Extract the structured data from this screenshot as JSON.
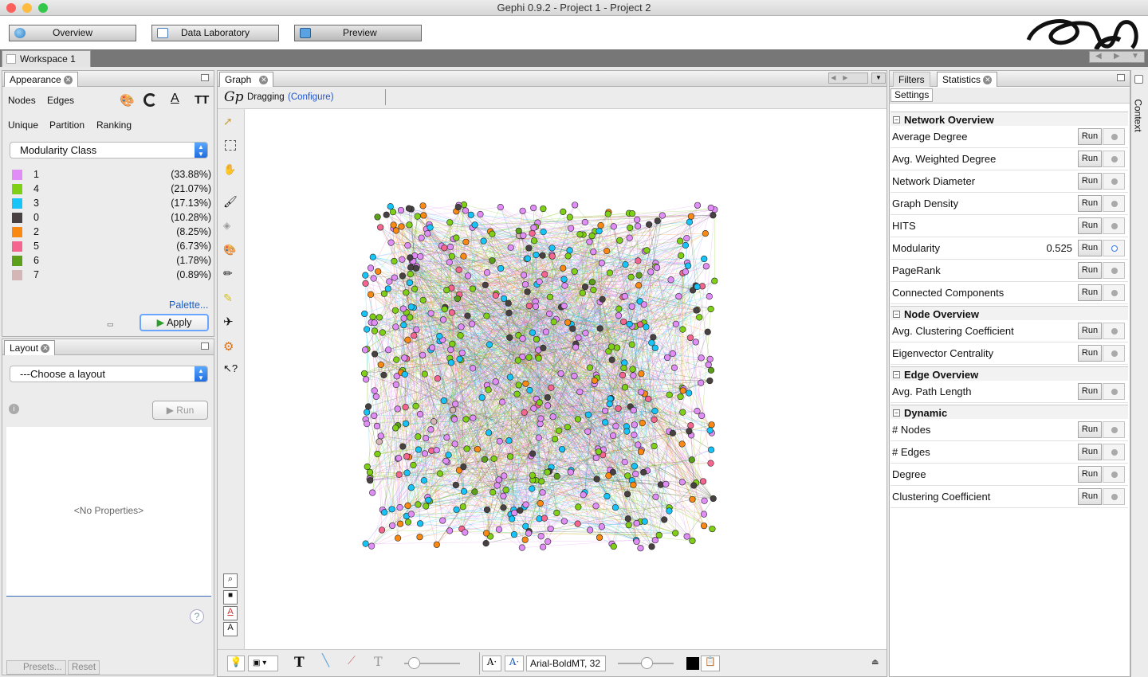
{
  "window": {
    "title": "Gephi 0.9.2 - Project 1 - Project 2"
  },
  "modes": [
    {
      "label": "Overview"
    },
    {
      "label": "Data Laboratory"
    },
    {
      "label": "Preview"
    }
  ],
  "workspace": {
    "tab": "Workspace 1"
  },
  "appearance": {
    "tab": "Appearance",
    "subtabs": [
      "Nodes",
      "Edges"
    ],
    "modes": [
      "Unique",
      "Partition",
      "Ranking"
    ],
    "attribute": "Modularity Class",
    "legend": [
      {
        "label": "1",
        "pct": "(33.88%)",
        "color": "#e08ef5"
      },
      {
        "label": "4",
        "pct": "(21.07%)",
        "color": "#7fcf16"
      },
      {
        "label": "3",
        "pct": "(17.13%)",
        "color": "#16c4f7"
      },
      {
        "label": "0",
        "pct": "(10.28%)",
        "color": "#484142"
      },
      {
        "label": "2",
        "pct": "(8.25%)",
        "color": "#fa8914"
      },
      {
        "label": "5",
        "pct": "(6.73%)",
        "color": "#f4668f"
      },
      {
        "label": "6",
        "pct": "(1.78%)",
        "color": "#5c9f1a"
      },
      {
        "label": "7",
        "pct": "(0.89%)",
        "color": "#d4b6b6"
      }
    ],
    "palette_link": "Palette...",
    "apply": "Apply"
  },
  "layout": {
    "tab": "Layout",
    "chooser": "---Choose a layout",
    "run": "Run",
    "no_properties": "<No Properties>",
    "presets": "Presets...",
    "reset": "Reset"
  },
  "graph": {
    "tab": "Graph",
    "mode": "Dragging",
    "configure": "(Configure)",
    "font": "Arial-BoldMT, 32"
  },
  "right": {
    "tabs": [
      "Filters",
      "Statistics"
    ],
    "settings": "Settings",
    "context": "Context",
    "run_label": "Run",
    "sections": [
      {
        "title": "Network Overview",
        "rows": [
          {
            "name": "Average Degree",
            "value": ""
          },
          {
            "name": "Avg. Weighted Degree",
            "value": ""
          },
          {
            "name": "Network Diameter",
            "value": ""
          },
          {
            "name": "Graph Density",
            "value": ""
          },
          {
            "name": "HITS",
            "value": ""
          },
          {
            "name": "Modularity",
            "value": "0.525"
          },
          {
            "name": "PageRank",
            "value": ""
          },
          {
            "name": "Connected Components",
            "value": ""
          }
        ]
      },
      {
        "title": "Node Overview",
        "rows": [
          {
            "name": "Avg. Clustering Coefficient",
            "value": ""
          },
          {
            "name": "Eigenvector Centrality",
            "value": ""
          }
        ]
      },
      {
        "title": "Edge Overview",
        "rows": [
          {
            "name": "Avg. Path Length",
            "value": ""
          }
        ]
      },
      {
        "title": "Dynamic",
        "rows": [
          {
            "name": "# Nodes",
            "value": ""
          },
          {
            "name": "# Edges",
            "value": ""
          },
          {
            "name": "Degree",
            "value": ""
          },
          {
            "name": "Clustering Coefficient",
            "value": ""
          }
        ]
      }
    ]
  }
}
